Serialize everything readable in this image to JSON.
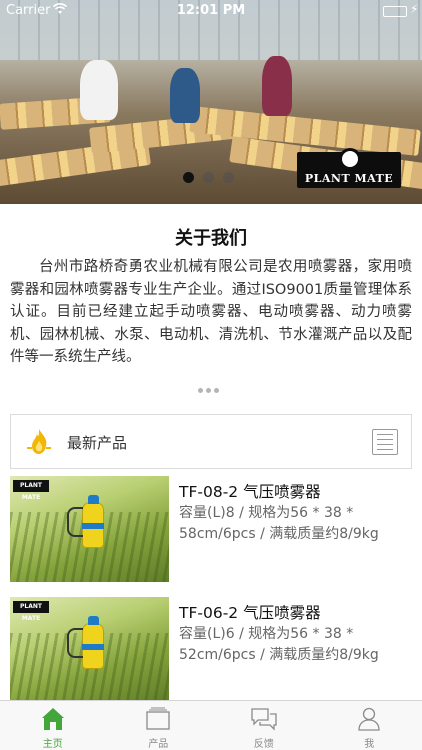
{
  "status_bar": {
    "carrier": "Carrier",
    "time": "12:01 PM"
  },
  "hero": {
    "brand_logo_text": "PLANT MATE",
    "slide_count": 3,
    "active_slide": 0
  },
  "about": {
    "title": "关于我们",
    "text": "台州市路桥奇勇农业机械有限公司是农用喷雾器，家用喷雾器和园林喷雾器专业生产企业。通过ISO9001质量管理体系认证。目前已经建立起手动喷雾器、电动喷雾器、动力喷雾机、园林机械、水泵、电动机、清洗机、节水灌溉产品以及配件等一系统生产线。"
  },
  "latest": {
    "title": "最新产品"
  },
  "products": [
    {
      "title": "TF-08-2 气压喷雾器",
      "desc": "容量(L)8 / 规格为56 * 38 * 58cm/6pcs / 满载质量约8/9kg",
      "thumb_logo": "PLANT MATE"
    },
    {
      "title": "TF-06-2 气压喷雾器",
      "desc": "容量(L)6 / 规格为56 * 38 * 52cm/6pcs / 满载质量约8/9kg",
      "thumb_logo": "PLANT MATE"
    }
  ],
  "tabs": [
    {
      "label": "主页",
      "icon": "home-icon",
      "active": true
    },
    {
      "label": "产品",
      "icon": "product-icon",
      "active": false
    },
    {
      "label": "反馈",
      "icon": "feedback-icon",
      "active": false
    },
    {
      "label": "我",
      "icon": "profile-icon",
      "active": false
    }
  ],
  "colors": {
    "accent": "#43a63a",
    "battery": "#4cd964",
    "sprayer": "#f0d31c",
    "sprayer_blue": "#1e7bc7"
  }
}
